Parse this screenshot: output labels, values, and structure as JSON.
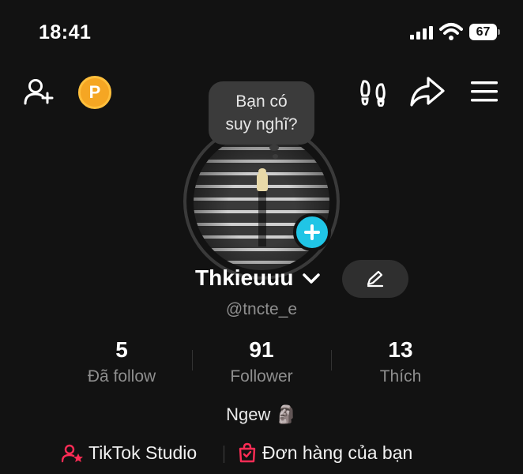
{
  "status_bar": {
    "time": "18:41",
    "battery": "67"
  },
  "top_nav": {
    "coin_letter": "P"
  },
  "bubble": {
    "line1": "Bạn có",
    "line2": "suy nghĩ?"
  },
  "profile": {
    "username": "Thkieuuu",
    "handle": "@tncte_e",
    "bio": "Ngew 🗿"
  },
  "stats": [
    {
      "value": "5",
      "label": "Đã follow"
    },
    {
      "value": "91",
      "label": "Follower"
    },
    {
      "value": "13",
      "label": "Thích"
    }
  ],
  "links": {
    "studio": "TikTok Studio",
    "orders": "Đơn hàng của bạn"
  },
  "colors": {
    "accent_plus": "#20c5e6",
    "coin": "#f5a623",
    "link_icon": "#fe2c55",
    "background": "#121212"
  },
  "icons": [
    "add-friend-icon",
    "coin-icon",
    "footprints-icon",
    "share-icon",
    "menu-icon",
    "chevron-down-icon",
    "pencil-icon",
    "plus-icon",
    "studio-icon",
    "shopping-bag-icon"
  ]
}
